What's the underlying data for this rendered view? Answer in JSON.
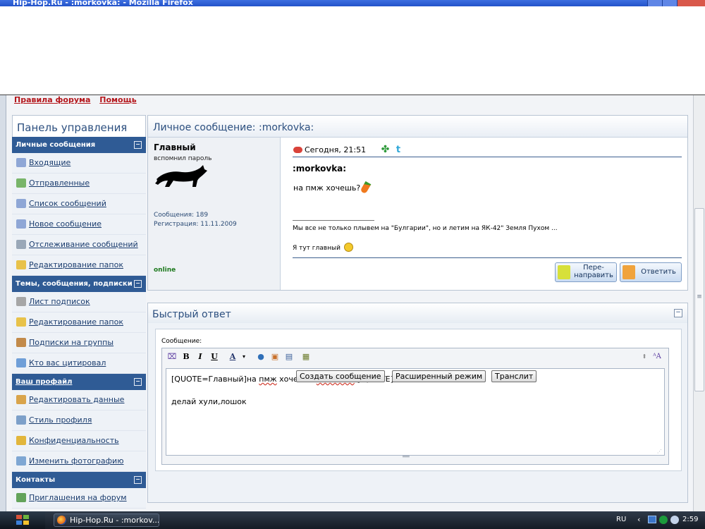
{
  "window": {
    "title": "Hip-Hop.Ru - :morkovka: - Mozilla Firefox",
    "buttons": [
      "_",
      "□",
      "×"
    ]
  },
  "top_links": [
    "Правила форума",
    "Помощь"
  ],
  "sidebar": {
    "title": "Панель управления",
    "sections": [
      {
        "title": "Личные сообщения",
        "items": [
          {
            "label": "Входящие",
            "icon": "inbox-icon",
            "color": "#8fa7d6"
          },
          {
            "label": "Отправленные",
            "icon": "sent-icon",
            "color": "#79b56a"
          },
          {
            "label": "Список сообщений",
            "icon": "list-icon",
            "color": "#8fa7d6"
          },
          {
            "label": "Новое сообщение",
            "icon": "new-message-icon",
            "color": "#8fa7d6"
          },
          {
            "label": "Отслеживание сообщений",
            "icon": "tracking-icon",
            "color": "#9aa8b8"
          },
          {
            "label": "Редактирование папок",
            "icon": "folder-icon",
            "color": "#e8c24a"
          }
        ]
      },
      {
        "title": "Темы, сообщения, подписки",
        "items": [
          {
            "label": "Лист подписок",
            "icon": "paperclip-icon",
            "color": "#a6a6a6"
          },
          {
            "label": "Редактирование папок",
            "icon": "folder-icon",
            "color": "#e8c24a"
          },
          {
            "label": "Подписки на группы",
            "icon": "groups-icon",
            "color": "#c28a4a"
          },
          {
            "label": "Кто вас цитировал",
            "icon": "quote-icon",
            "color": "#6f9fd8"
          }
        ]
      },
      {
        "title": "Ваш профайл",
        "items": [
          {
            "label": "Редактировать данные",
            "icon": "profile-edit-icon",
            "color": "#d9a44b"
          },
          {
            "label": "Стиль профиля",
            "icon": "style-icon",
            "color": "#7da0c9"
          },
          {
            "label": "Конфиденциальность",
            "icon": "key-icon",
            "color": "#e2b63c"
          },
          {
            "label": "Изменить фотографию",
            "icon": "photo-icon",
            "color": "#7fa7d3"
          }
        ]
      },
      {
        "title": "Контакты",
        "items": [
          {
            "label": "Приглашения на форум",
            "icon": "invite-icon",
            "color": "#63a35a"
          }
        ]
      }
    ],
    "toggle_symbol": "−"
  },
  "message": {
    "panel_title": "Личное сообщение: :morkovka:",
    "user": {
      "name": "Главный",
      "title": "вспомнил пароль",
      "stats": [
        "Сообщения: 189",
        "Регистрация: 11.11.2009"
      ],
      "status": "online"
    },
    "date": "Сегодня, 21:51",
    "subject": ":morkovka:",
    "text": "на пмж хочешь?",
    "signature_1": "Мы все не только плывем на \"Булгарии\", но и летим на ЯК-42\" Земля Пухом ...",
    "signature_2": "Я тут главный",
    "buttons": {
      "forward": "Пере-\nнаправить",
      "reply": "Ответить"
    }
  },
  "quick_reply": {
    "title": "Быстрый ответ",
    "label": "Сообщение:",
    "toolbar": [
      "B",
      "I",
      "U",
      "A"
    ],
    "content": {
      "line1_prefix": "[QUOTE=Главный]на ",
      "line1_squiggle1": "пмж",
      "line1_mid": " хочешь?:",
      "line1_squiggle2": "morkovka",
      "line1_suffix": ":[/QUOTE]",
      "line2": "делай хули,лошок"
    },
    "buttons": [
      "Создать сообщение",
      "Расширенный режим",
      "Транслит"
    ]
  },
  "taskbar": {
    "task": "Hip-Hop.Ru - :morkov...",
    "lang": "RU",
    "time": "2:59"
  },
  "colors": {
    "accent": "#2f5b95",
    "link": "#1a3c6e",
    "forum_rules": "#b4161b"
  }
}
